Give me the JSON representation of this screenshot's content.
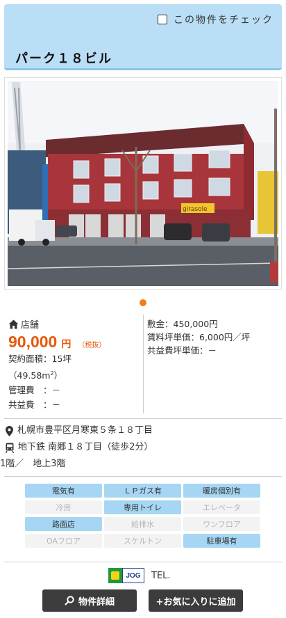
{
  "header": {
    "check_label": "この物件をチェック",
    "title": "パーク１８ビル"
  },
  "photo": {
    "sign_text": "girasole"
  },
  "listing": {
    "type_icon": "house-icon",
    "type": "店舗",
    "price": "90,000",
    "price_unit": "円",
    "tax_note": "（税抜）",
    "area_line1": "契約面積：15坪",
    "area_line2_prefix": "（49.58m",
    "area_line2_suffix": "）",
    "management_fee": "管理費　：－",
    "common_fee": "共益費　：－",
    "deposit": "敷金：450,000円",
    "rent_per_tsubo": "賃料坪単価：6,000円／坪",
    "common_per_tsubo": "共益費坪単価：－"
  },
  "location": {
    "address": "札幌市豊平区月寒東５条１８丁目",
    "station": "地下鉄 南郷１８丁目（徒歩2分）",
    "floors": "1階／　地上3階"
  },
  "tags": [
    {
      "label": "電気有",
      "active": true
    },
    {
      "label": "ＬＰガス有",
      "active": true
    },
    {
      "label": "暖房個別有",
      "active": true
    },
    {
      "label": "冷房",
      "active": false
    },
    {
      "label": "専用トイレ",
      "active": true
    },
    {
      "label": "エレベータ",
      "active": false
    },
    {
      "label": "路面店",
      "active": true
    },
    {
      "label": "給排水",
      "active": false
    },
    {
      "label": "ワンフロア",
      "active": false
    },
    {
      "label": "OAフロア",
      "active": false
    },
    {
      "label": "スケルトン",
      "active": false
    },
    {
      "label": "駐車場有",
      "active": true
    }
  ],
  "company": {
    "logo_text": "JOG",
    "tel_label": "TEL."
  },
  "buttons": {
    "detail": "物件詳細",
    "favorite": "+お気に入りに追加"
  },
  "colors": {
    "header_bg": "#b9def5",
    "price": "#e8580a",
    "tag_active": "#a6d6f3",
    "button_bg": "#3c3c3c"
  }
}
